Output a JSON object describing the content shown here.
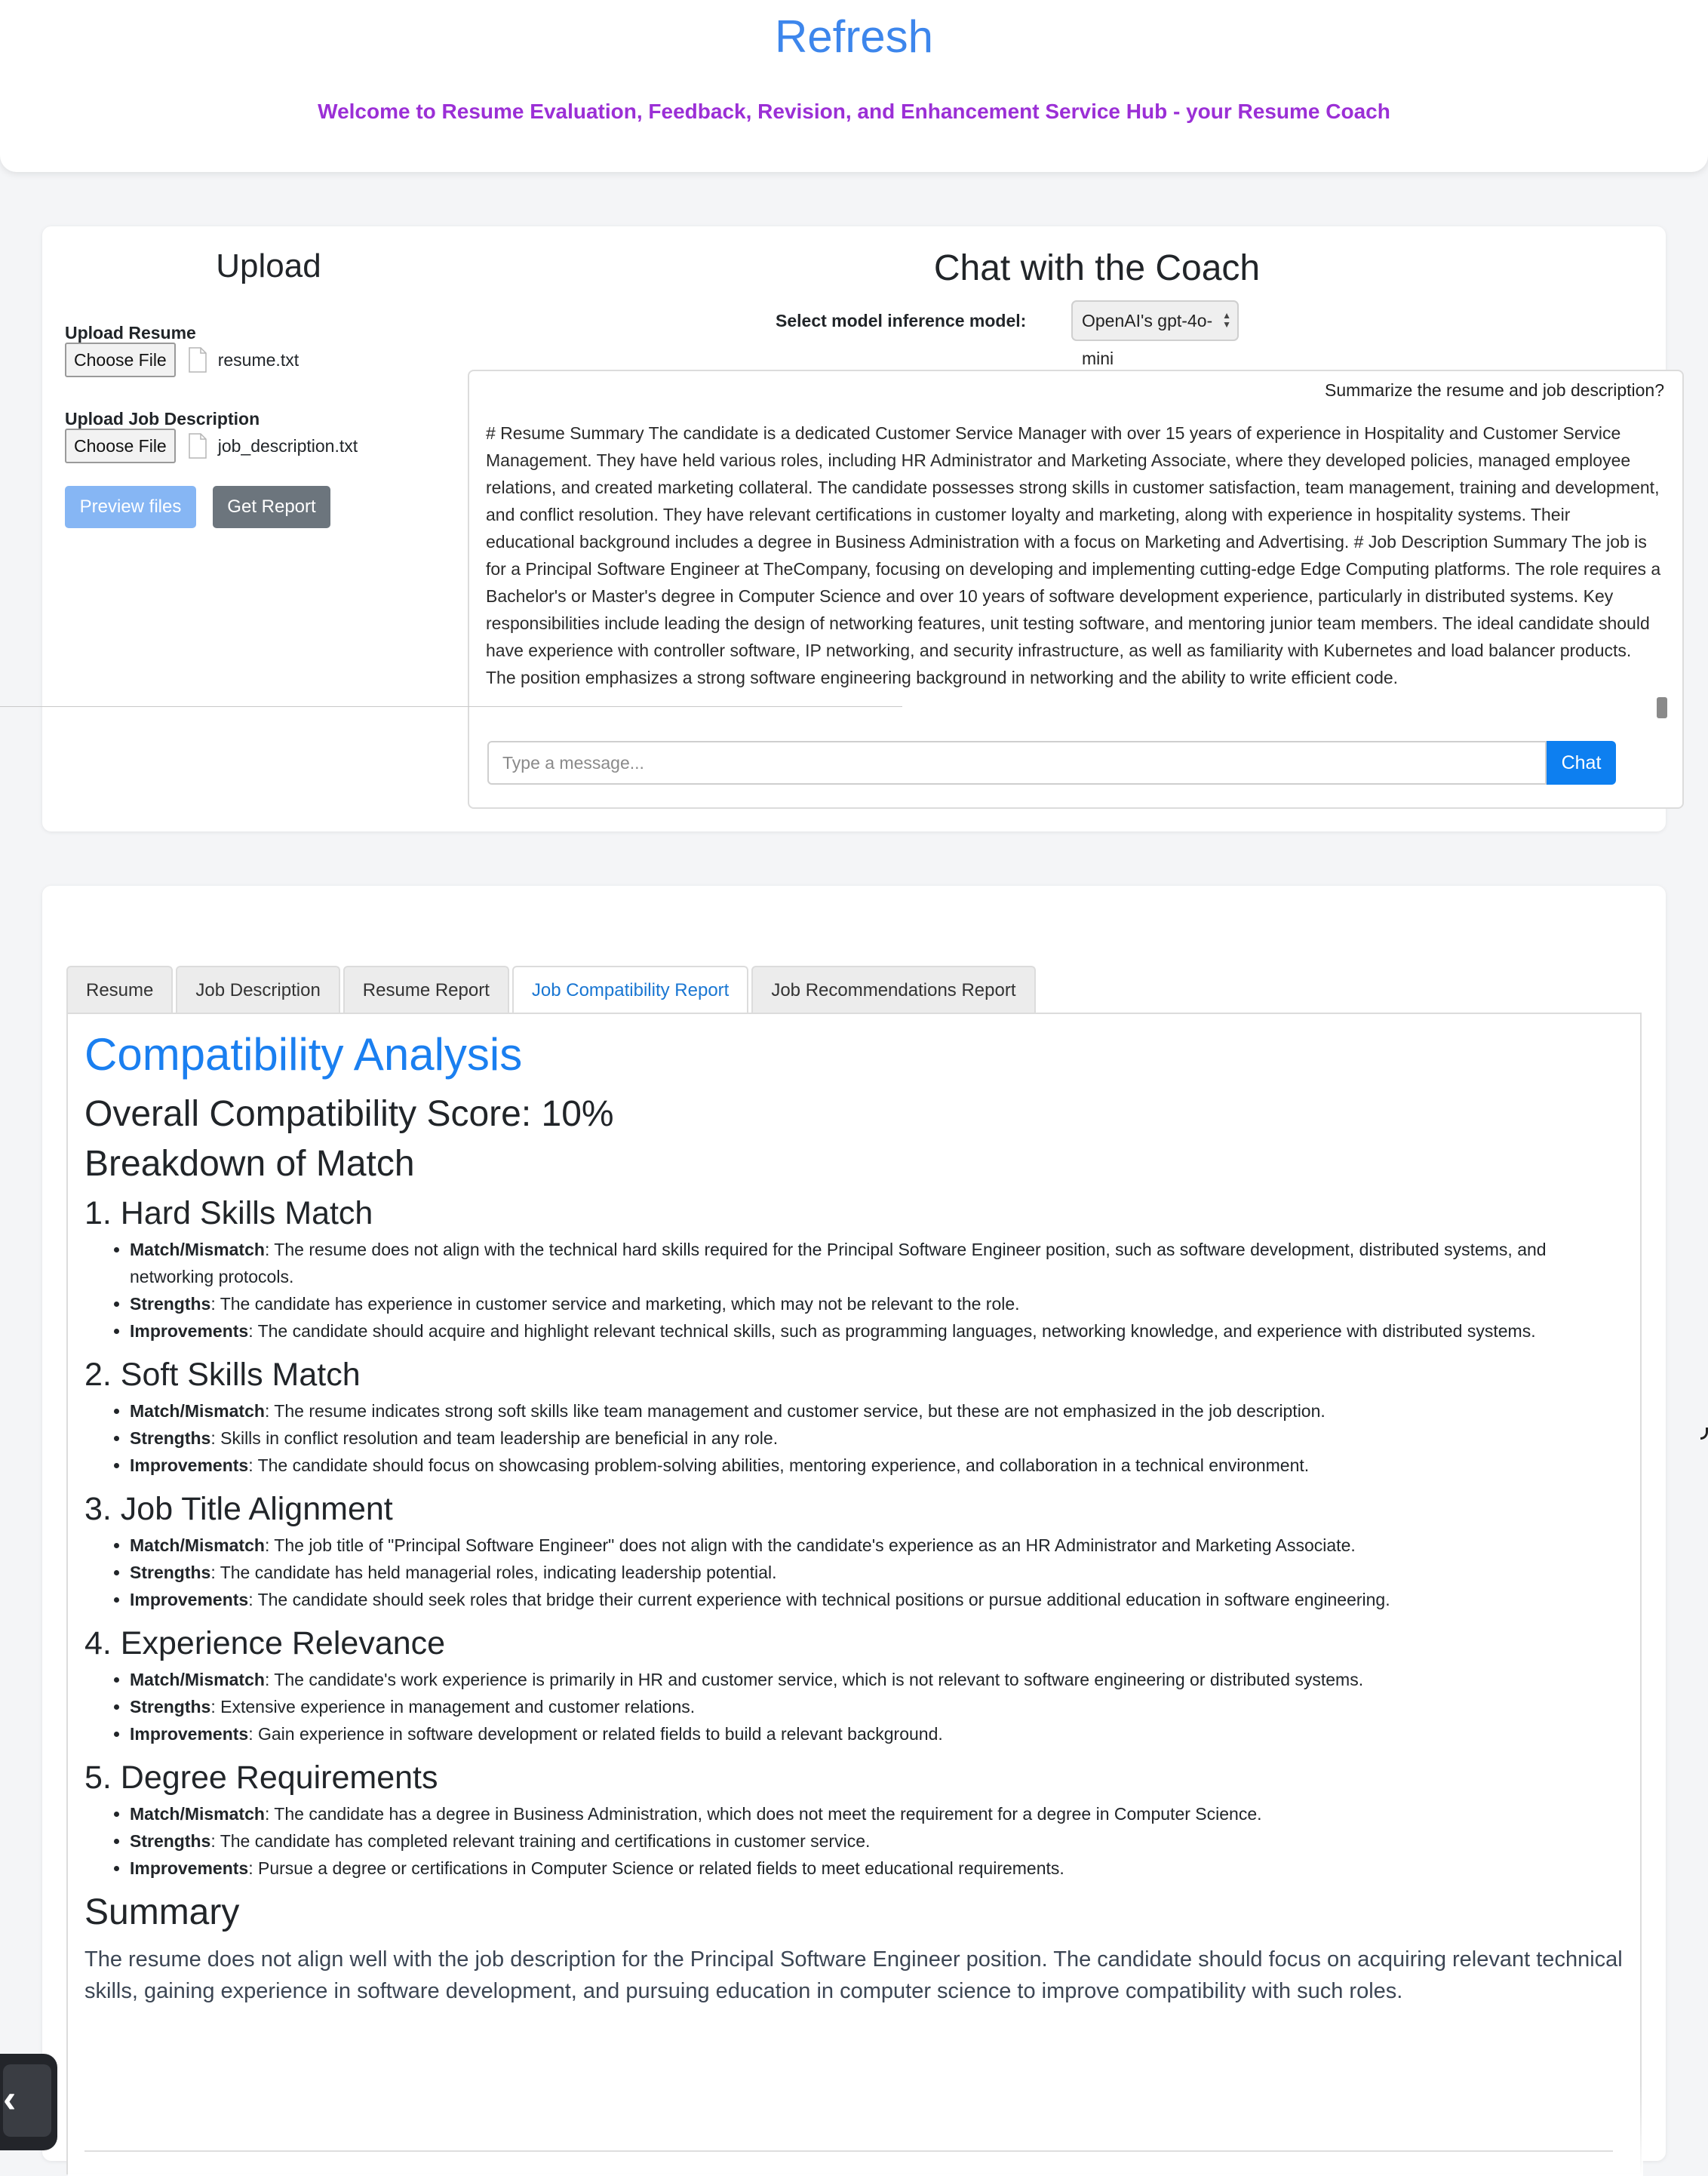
{
  "header": {
    "title": "Refresh",
    "subtitle": "Welcome to Resume Evaluation, Feedback, Revision, and Enhancement Service Hub - your Resume Coach"
  },
  "upload": {
    "title": "Upload",
    "resume_label": "Upload Resume",
    "resume_button": "Choose File",
    "resume_file": "resume.txt",
    "jd_label": "Upload Job Description",
    "jd_button": "Choose File",
    "jd_file": "job_description.txt",
    "preview_button": "Preview files",
    "report_button": "Get Report"
  },
  "chat": {
    "title": "Chat with the Coach",
    "model_label": "Select model inference model:",
    "model_value": "OpenAI's gpt-4o-mini",
    "user_message": "Summarize the resume and job description?",
    "reply": "# Resume Summary The candidate is a dedicated Customer Service Manager with over 15 years of experience in Hospitality and Customer Service Management. They have held various roles, including HR Administrator and Marketing Associate, where they developed policies, managed employee relations, and created marketing collateral. The candidate possesses strong skills in customer satisfaction, team management, training and development, and conflict resolution. They have relevant certifications in customer loyalty and marketing, along with experience in hospitality systems. Their educational background includes a degree in Business Administration with a focus on Marketing and Advertising. # Job Description Summary The job is for a Principal Software Engineer at TheCompany, focusing on developing and implementing cutting-edge Edge Computing platforms. The role requires a Bachelor's or Master's degree in Computer Science and over 10 years of software development experience, particularly in distributed systems. Key responsibilities include leading the design of networking features, unit testing software, and mentoring junior team members. The ideal candidate should have experience with controller software, IP networking, and security infrastructure, as well as familiarity with Kubernetes and load balancer products. The position emphasizes a strong software engineering background in networking and the ability to write efficient code.",
    "input_placeholder": "Type a message...",
    "send_button": "Chat"
  },
  "tabs": [
    {
      "label": "Resume"
    },
    {
      "label": "Job Description"
    },
    {
      "label": "Resume Report"
    },
    {
      "label": "Job Compatibility Report",
      "active": true
    },
    {
      "label": "Job Recommendations Report"
    }
  ],
  "report": {
    "title": "Compatibility Analysis",
    "score": "Overall Compatibility Score: 10%",
    "breakdown": "Breakdown of Match",
    "sections": [
      {
        "heading": "1. Hard Skills Match",
        "items": [
          {
            "key": "Match/Mismatch",
            "text": ": The resume does not align with the technical hard skills required for the Principal Software Engineer position, such as software development, distributed systems, and networking protocols."
          },
          {
            "key": "Strengths",
            "text": ": The candidate has experience in customer service and marketing, which may not be relevant to the role."
          },
          {
            "key": "Improvements",
            "text": ": The candidate should acquire and highlight relevant technical skills, such as programming languages, networking knowledge, and experience with distributed systems."
          }
        ]
      },
      {
        "heading": "2. Soft Skills Match",
        "items": [
          {
            "key": "Match/Mismatch",
            "text": ": The resume indicates strong soft skills like team management and customer service, but these are not emphasized in the job description."
          },
          {
            "key": "Strengths",
            "text": ": Skills in conflict resolution and team leadership are beneficial in any role."
          },
          {
            "key": "Improvements",
            "text": ": The candidate should focus on showcasing problem-solving abilities, mentoring experience, and collaboration in a technical environment."
          }
        ]
      },
      {
        "heading": "3. Job Title Alignment",
        "items": [
          {
            "key": "Match/Mismatch",
            "text": ": The job title of \"Principal Software Engineer\" does not align with the candidate's experience as an HR Administrator and Marketing Associate."
          },
          {
            "key": "Strengths",
            "text": ": The candidate has held managerial roles, indicating leadership potential."
          },
          {
            "key": "Improvements",
            "text": ": The candidate should seek roles that bridge their current experience with technical positions or pursue additional education in software engineering."
          }
        ]
      },
      {
        "heading": "4. Experience Relevance",
        "items": [
          {
            "key": "Match/Mismatch",
            "text": ": The candidate's work experience is primarily in HR and customer service, which is not relevant to software engineering or distributed systems."
          },
          {
            "key": "Strengths",
            "text": ": Extensive experience in management and customer relations."
          },
          {
            "key": "Improvements",
            "text": ": Gain experience in software development or related fields to build a relevant background."
          }
        ]
      },
      {
        "heading": "5. Degree Requirements",
        "items": [
          {
            "key": "Match/Mismatch",
            "text": ": The candidate has a degree in Business Administration, which does not meet the requirement for a degree in Computer Science."
          },
          {
            "key": "Strengths",
            "text": ": The candidate has completed relevant training and certifications in customer service."
          },
          {
            "key": "Improvements",
            "text": ": Pursue a degree or certifications in Computer Science or related fields to meet educational requirements."
          }
        ]
      }
    ],
    "summary_heading": "Summary",
    "summary_text": "The resume does not align well with the job description for the Principal Software Engineer position. The candidate should focus on acquiring relevant technical skills, gaining experience in software development, and pursuing education in computer science to improve compatibility with such roles."
  },
  "widget": {
    "glyph": "‹"
  },
  "colors": {
    "title_blue": "#3d86ec",
    "subtitle_purple": "#9b2fd6",
    "primary": "#0d7ff0",
    "secondary": "#6c757d"
  }
}
